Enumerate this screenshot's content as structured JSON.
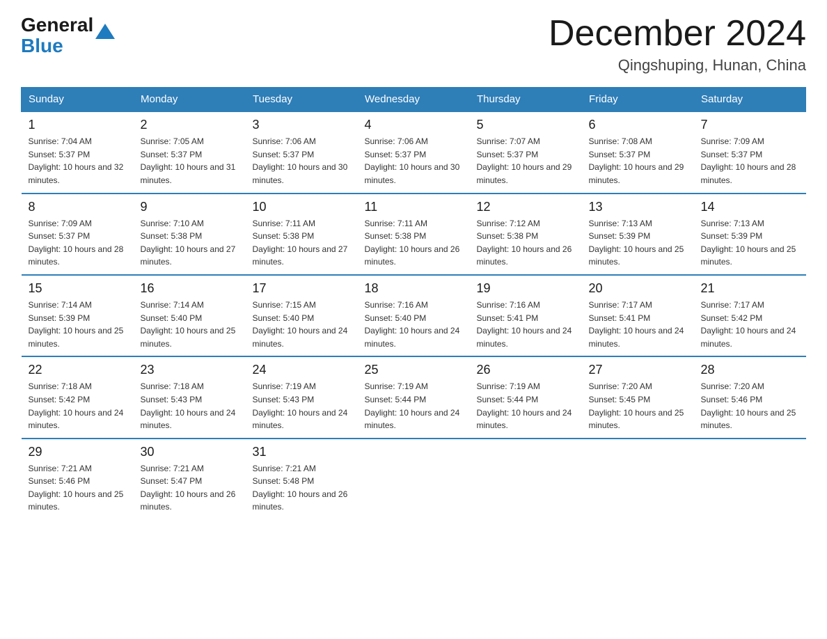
{
  "logo": {
    "general": "General",
    "blue": "Blue"
  },
  "title": "December 2024",
  "location": "Qingshuping, Hunan, China",
  "days_of_week": [
    "Sunday",
    "Monday",
    "Tuesday",
    "Wednesday",
    "Thursday",
    "Friday",
    "Saturday"
  ],
  "weeks": [
    [
      {
        "day": "1",
        "sunrise": "7:04 AM",
        "sunset": "5:37 PM",
        "daylight": "10 hours and 32 minutes."
      },
      {
        "day": "2",
        "sunrise": "7:05 AM",
        "sunset": "5:37 PM",
        "daylight": "10 hours and 31 minutes."
      },
      {
        "day": "3",
        "sunrise": "7:06 AM",
        "sunset": "5:37 PM",
        "daylight": "10 hours and 30 minutes."
      },
      {
        "day": "4",
        "sunrise": "7:06 AM",
        "sunset": "5:37 PM",
        "daylight": "10 hours and 30 minutes."
      },
      {
        "day": "5",
        "sunrise": "7:07 AM",
        "sunset": "5:37 PM",
        "daylight": "10 hours and 29 minutes."
      },
      {
        "day": "6",
        "sunrise": "7:08 AM",
        "sunset": "5:37 PM",
        "daylight": "10 hours and 29 minutes."
      },
      {
        "day": "7",
        "sunrise": "7:09 AM",
        "sunset": "5:37 PM",
        "daylight": "10 hours and 28 minutes."
      }
    ],
    [
      {
        "day": "8",
        "sunrise": "7:09 AM",
        "sunset": "5:37 PM",
        "daylight": "10 hours and 28 minutes."
      },
      {
        "day": "9",
        "sunrise": "7:10 AM",
        "sunset": "5:38 PM",
        "daylight": "10 hours and 27 minutes."
      },
      {
        "day": "10",
        "sunrise": "7:11 AM",
        "sunset": "5:38 PM",
        "daylight": "10 hours and 27 minutes."
      },
      {
        "day": "11",
        "sunrise": "7:11 AM",
        "sunset": "5:38 PM",
        "daylight": "10 hours and 26 minutes."
      },
      {
        "day": "12",
        "sunrise": "7:12 AM",
        "sunset": "5:38 PM",
        "daylight": "10 hours and 26 minutes."
      },
      {
        "day": "13",
        "sunrise": "7:13 AM",
        "sunset": "5:39 PM",
        "daylight": "10 hours and 25 minutes."
      },
      {
        "day": "14",
        "sunrise": "7:13 AM",
        "sunset": "5:39 PM",
        "daylight": "10 hours and 25 minutes."
      }
    ],
    [
      {
        "day": "15",
        "sunrise": "7:14 AM",
        "sunset": "5:39 PM",
        "daylight": "10 hours and 25 minutes."
      },
      {
        "day": "16",
        "sunrise": "7:14 AM",
        "sunset": "5:40 PM",
        "daylight": "10 hours and 25 minutes."
      },
      {
        "day": "17",
        "sunrise": "7:15 AM",
        "sunset": "5:40 PM",
        "daylight": "10 hours and 24 minutes."
      },
      {
        "day": "18",
        "sunrise": "7:16 AM",
        "sunset": "5:40 PM",
        "daylight": "10 hours and 24 minutes."
      },
      {
        "day": "19",
        "sunrise": "7:16 AM",
        "sunset": "5:41 PM",
        "daylight": "10 hours and 24 minutes."
      },
      {
        "day": "20",
        "sunrise": "7:17 AM",
        "sunset": "5:41 PM",
        "daylight": "10 hours and 24 minutes."
      },
      {
        "day": "21",
        "sunrise": "7:17 AM",
        "sunset": "5:42 PM",
        "daylight": "10 hours and 24 minutes."
      }
    ],
    [
      {
        "day": "22",
        "sunrise": "7:18 AM",
        "sunset": "5:42 PM",
        "daylight": "10 hours and 24 minutes."
      },
      {
        "day": "23",
        "sunrise": "7:18 AM",
        "sunset": "5:43 PM",
        "daylight": "10 hours and 24 minutes."
      },
      {
        "day": "24",
        "sunrise": "7:19 AM",
        "sunset": "5:43 PM",
        "daylight": "10 hours and 24 minutes."
      },
      {
        "day": "25",
        "sunrise": "7:19 AM",
        "sunset": "5:44 PM",
        "daylight": "10 hours and 24 minutes."
      },
      {
        "day": "26",
        "sunrise": "7:19 AM",
        "sunset": "5:44 PM",
        "daylight": "10 hours and 24 minutes."
      },
      {
        "day": "27",
        "sunrise": "7:20 AM",
        "sunset": "5:45 PM",
        "daylight": "10 hours and 25 minutes."
      },
      {
        "day": "28",
        "sunrise": "7:20 AM",
        "sunset": "5:46 PM",
        "daylight": "10 hours and 25 minutes."
      }
    ],
    [
      {
        "day": "29",
        "sunrise": "7:21 AM",
        "sunset": "5:46 PM",
        "daylight": "10 hours and 25 minutes."
      },
      {
        "day": "30",
        "sunrise": "7:21 AM",
        "sunset": "5:47 PM",
        "daylight": "10 hours and 26 minutes."
      },
      {
        "day": "31",
        "sunrise": "7:21 AM",
        "sunset": "5:48 PM",
        "daylight": "10 hours and 26 minutes."
      },
      null,
      null,
      null,
      null
    ]
  ],
  "labels": {
    "sunrise_prefix": "Sunrise: ",
    "sunset_prefix": "Sunset: ",
    "daylight_prefix": "Daylight: "
  }
}
